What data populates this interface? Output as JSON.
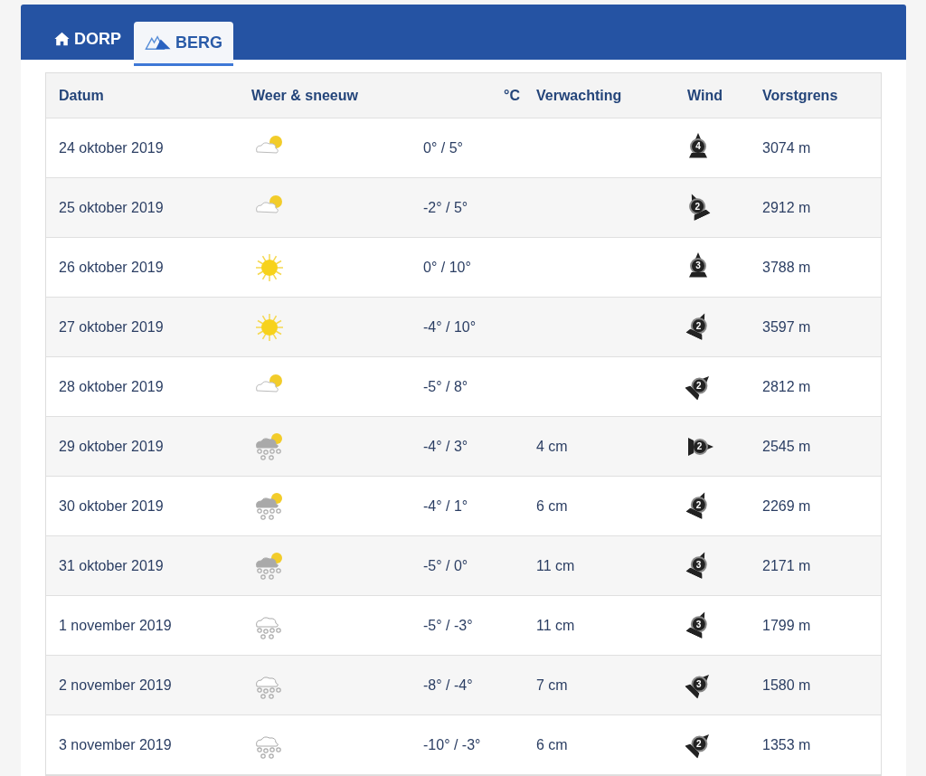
{
  "tabs": [
    {
      "label": "DORP",
      "kind": "house",
      "selected": false
    },
    {
      "label": "BERG",
      "kind": "mountain",
      "selected": true
    }
  ],
  "table": {
    "columns": [
      "Datum",
      "Weer & sneeuw",
      "°C",
      "Verwachting",
      "Wind",
      "Vorstgrens"
    ],
    "rows": [
      {
        "date": "24 oktober 2019",
        "kind": "partly-cloudy",
        "temp": "0° / 5°",
        "wind": {
          "force": "4",
          "kind": "n"
        },
        "freezing_level": "3074 m"
      },
      {
        "date": "25 oktober 2019",
        "kind": "partly-cloudy",
        "temp": "-2° / 5°",
        "wind": {
          "force": "2",
          "kind": "nnw"
        },
        "freezing_level": "2912 m"
      },
      {
        "date": "26 oktober 2019",
        "kind": "sunny",
        "temp": "0° / 10°",
        "wind": {
          "force": "3",
          "kind": "n"
        },
        "freezing_level": "3788 m"
      },
      {
        "date": "27 oktober 2019",
        "kind": "sunny",
        "temp": "-4° / 10°",
        "wind": {
          "force": "2",
          "kind": "nne"
        },
        "freezing_level": "3597 m"
      },
      {
        "date": "28 oktober 2019",
        "kind": "partly-cloudy",
        "temp": "-5° / 8°",
        "wind": {
          "force": "2",
          "kind": "ne"
        },
        "freezing_level": "2812 m"
      },
      {
        "date": "29 oktober 2019",
        "kind": "snow-sun",
        "temp": "-4° / 3°",
        "snow": "4 cm",
        "wind": {
          "force": "2",
          "kind": "e"
        },
        "freezing_level": "2545 m"
      },
      {
        "date": "30 oktober 2019",
        "kind": "snow-sun",
        "temp": "-4° / 1°",
        "snow": "6 cm",
        "wind": {
          "force": "2",
          "kind": "nne"
        },
        "freezing_level": "2269 m"
      },
      {
        "date": "31 oktober 2019",
        "kind": "snow-sun",
        "temp": "-5° / 0°",
        "snow": "11 cm",
        "wind": {
          "force": "3",
          "kind": "nne"
        },
        "freezing_level": "2171 m"
      },
      {
        "date": "1 november 2019",
        "kind": "snow",
        "temp": "-5° / -3°",
        "snow": "11 cm",
        "wind": {
          "force": "3",
          "kind": "nne"
        },
        "freezing_level": "1799 m"
      },
      {
        "date": "2 november 2019",
        "kind": "snow",
        "temp": "-8° / -4°",
        "snow": "7 cm",
        "wind": {
          "force": "3",
          "kind": "ne"
        },
        "freezing_level": "1580 m"
      },
      {
        "date": "3 november 2019",
        "kind": "snow",
        "temp": "-10° / -3°",
        "snow": "6 cm",
        "wind": {
          "force": "2",
          "kind": "ne"
        },
        "freezing_level": "1353 m"
      }
    ]
  }
}
